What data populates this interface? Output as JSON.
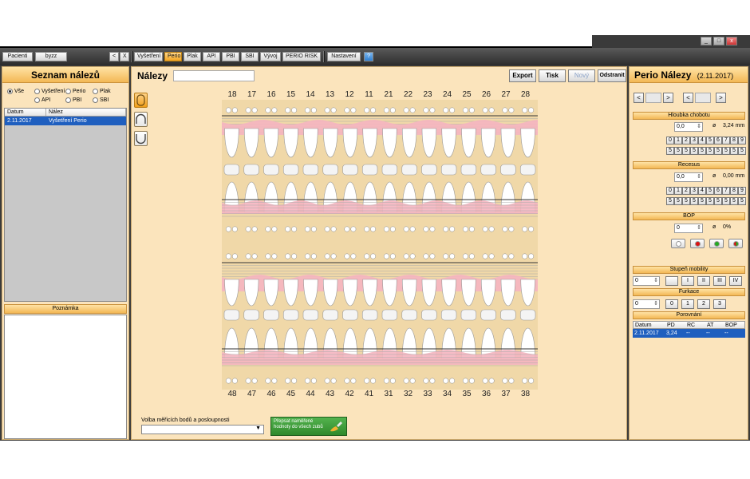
{
  "window": {
    "controls": [
      "_",
      "□",
      "x"
    ]
  },
  "toolbar": {
    "patients": "Pacienti",
    "patient_name": "byzz",
    "nav_prev": "<",
    "close": "X",
    "tabs": [
      "Vyšetření",
      "Perio",
      "Plak",
      "API",
      "PBI",
      "SBI",
      "Vývoj",
      "PERIO RISK"
    ],
    "active_tab": "Perio",
    "settings": "Nastavení",
    "help": "?"
  },
  "left": {
    "title": "Seznam nálezů",
    "filters": [
      "Vše",
      "Vyšetření",
      "Perio",
      "Plak",
      "API",
      "PBI",
      "SBI"
    ],
    "selected_filter": "Vše",
    "columns": [
      "Datum",
      "Nález"
    ],
    "rows": [
      {
        "date": "2.11.2017",
        "finding": "Vyšetření Perio"
      }
    ],
    "note_label": "Poznámka"
  },
  "center": {
    "title": "Nálezy",
    "buttons": {
      "export": "Export",
      "print": "Tisk",
      "new": "Nový",
      "remove": "Odstranit"
    },
    "upper_teeth": [
      "18",
      "17",
      "16",
      "15",
      "14",
      "13",
      "12",
      "11",
      "21",
      "22",
      "23",
      "24",
      "25",
      "26",
      "27",
      "28"
    ],
    "lower_teeth": [
      "48",
      "47",
      "46",
      "45",
      "44",
      "43",
      "42",
      "41",
      "31",
      "32",
      "33",
      "34",
      "35",
      "36",
      "37",
      "38"
    ],
    "sequence_label": "Volba měřicích bodů a posloupnosti",
    "apply_button": "Přepsat naměřené hodnoty do všech zubů"
  },
  "right": {
    "title": "Perio Nálezy",
    "date": "(2.11.2017)",
    "nav": [
      "<",
      ">",
      "<",
      ">"
    ],
    "pocket": {
      "title": "Hloubka chobotu",
      "value": "0,0",
      "avg_symbol": "ø",
      "avg": "3,24 mm",
      "digits_row1": [
        "0",
        "1",
        "2",
        "3",
        "4",
        "5",
        "6",
        "7",
        "8",
        "9"
      ],
      "digits_row2": [
        "5",
        "5",
        "5",
        "5",
        "5",
        "5",
        "5",
        "5",
        "5",
        "5"
      ]
    },
    "recession": {
      "title": "Recesus",
      "value": "0,0",
      "avg_symbol": "ø",
      "avg": "0,00 mm",
      "digits_row1": [
        "0",
        "1",
        "2",
        "3",
        "4",
        "5",
        "6",
        "7",
        "8",
        "9"
      ],
      "digits_row2": [
        "5",
        "5",
        "5",
        "5",
        "5",
        "5",
        "5",
        "5",
        "5",
        "5"
      ]
    },
    "bop": {
      "title": "BOP",
      "value": "0",
      "avg_symbol": "ø",
      "avg": "0%",
      "colors": [
        "#ffffff",
        "#dd1111",
        "#22aa22",
        "#dd1111"
      ]
    },
    "mobility": {
      "title": "Stupeň mobility",
      "value": "0",
      "options": [
        "",
        "I",
        "II",
        "III",
        "IV"
      ]
    },
    "furcation": {
      "title": "Furkace",
      "value": "0",
      "options": [
        "0",
        "1",
        "2",
        "3"
      ]
    },
    "comparison": {
      "title": "Porovnání",
      "columns": [
        "Datum",
        "PD",
        "RC",
        "AT",
        "BOP"
      ],
      "rows": [
        {
          "date": "2.11.2017",
          "pd": "3,24",
          "rc": "--",
          "at": "--",
          "bop": "--"
        }
      ]
    }
  },
  "colors": {
    "accent": "#f3b855",
    "panel": "#fbe4bc",
    "selection": "#1f5fbf",
    "gum": "#f5b5c0"
  }
}
